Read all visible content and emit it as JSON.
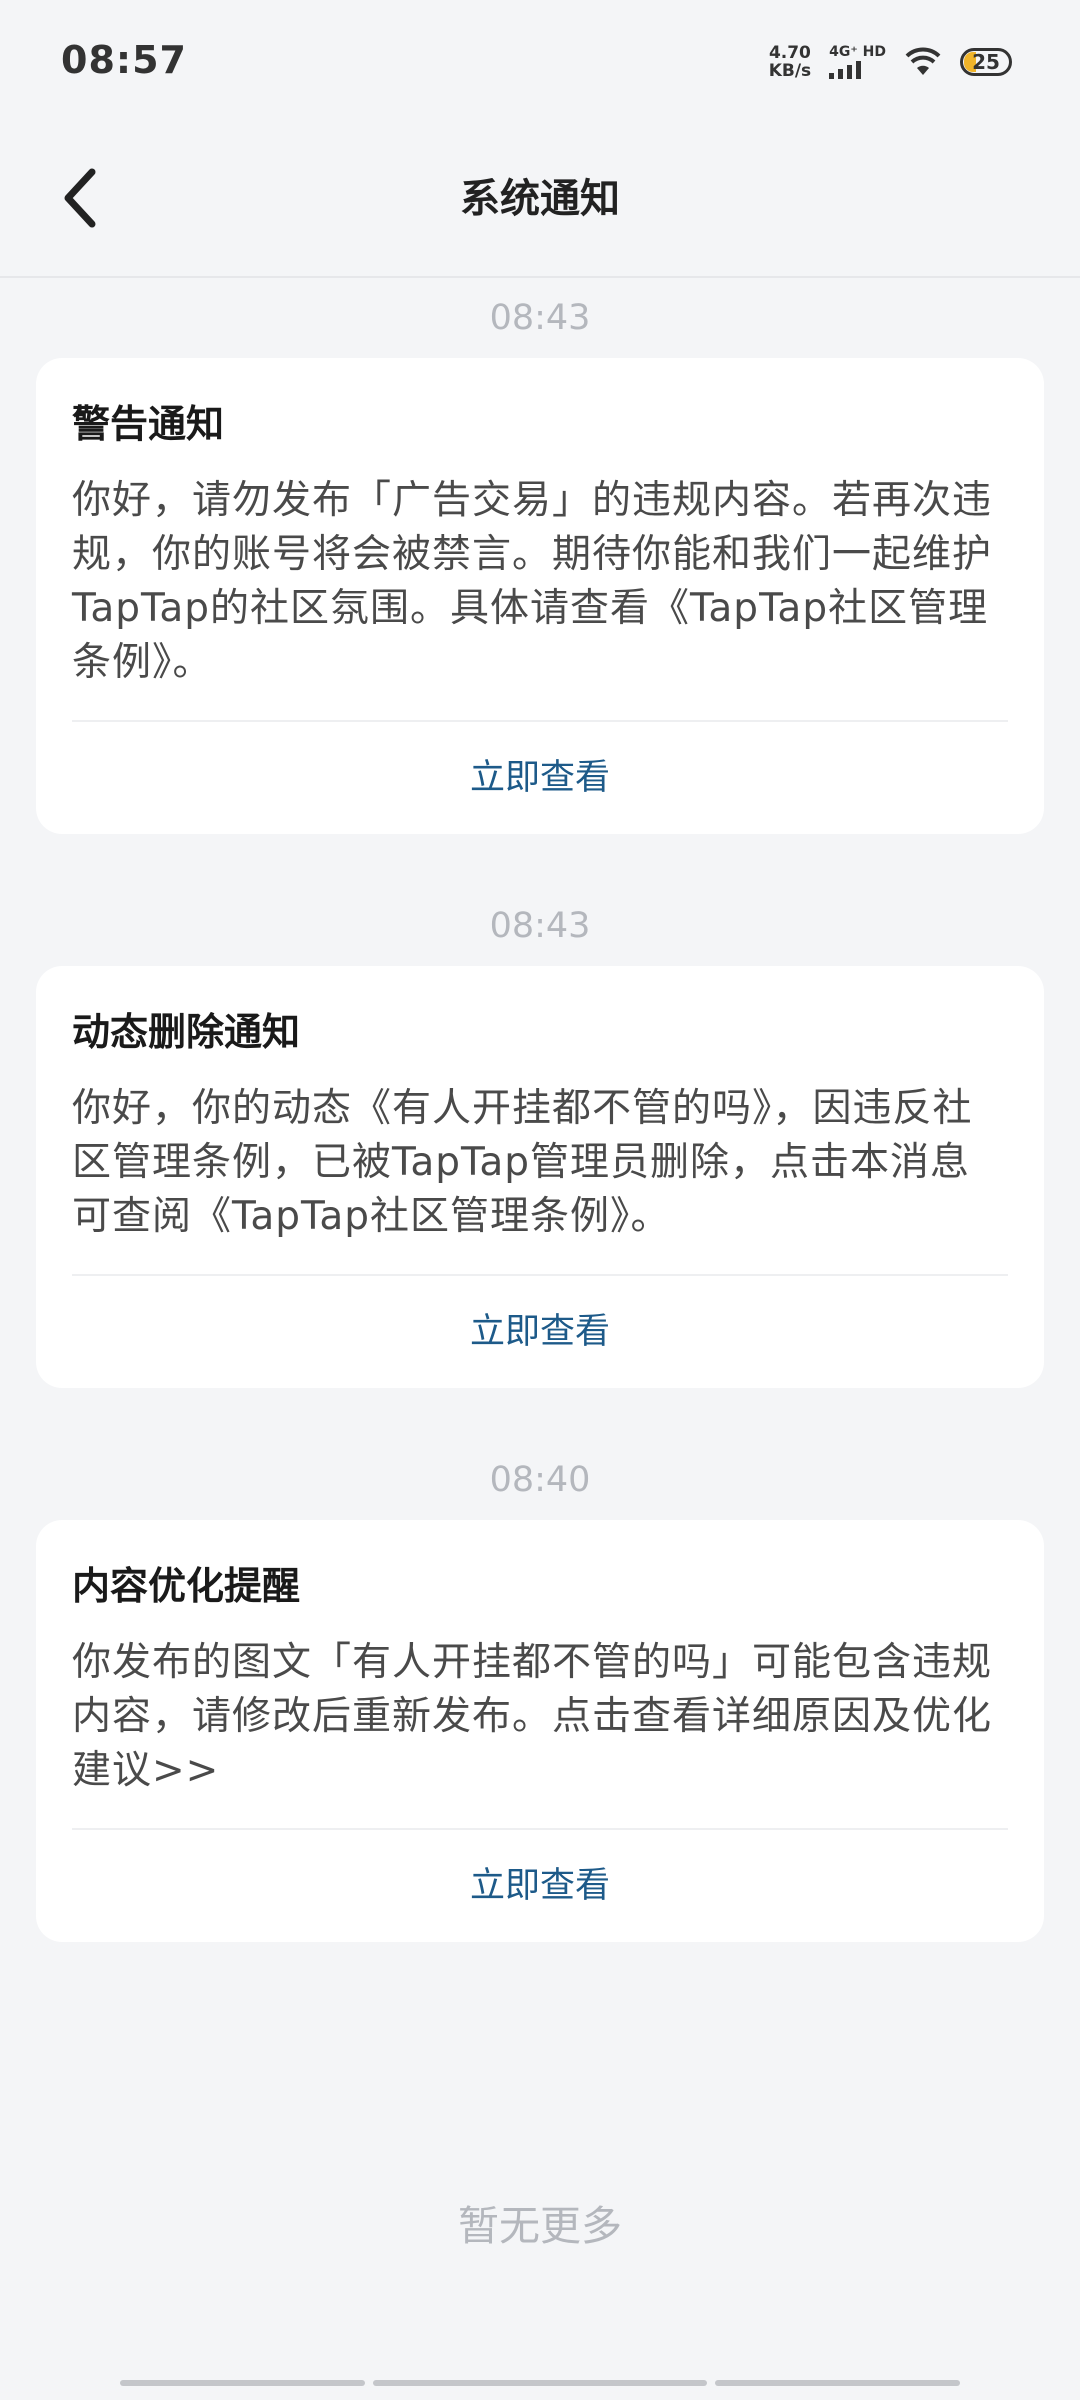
{
  "status_bar": {
    "time": "08:57",
    "speed_value": "4.70",
    "speed_unit": "KB/s",
    "network": "4G⁺ HD",
    "battery": "25"
  },
  "header": {
    "title": "系统通知"
  },
  "notifications": [
    {
      "time": "08:43",
      "title": "警告通知",
      "body": "你好，请勿发布「广告交易」的违规内容。若再次违规，你的账号将会被禁言。期待你能和我们一起维护TapTap的社区氛围。具体请查看《TapTap社区管理条例》。",
      "action": "立即查看"
    },
    {
      "time": "08:43",
      "title": "动态删除通知",
      "body": "你好，你的动态《有人开挂都不管的吗》，因违反社区管理条例，已被TapTap管理员删除，点击本消息可查阅《TapTap社区管理条例》。",
      "action": "立即查看"
    },
    {
      "time": "08:40",
      "title": "内容优化提醒",
      "body": "你发布的图文「有人开挂都不管的吗」可能包含违规内容，请修改后重新发布。点击查看详细原因及优化建议>>",
      "action": "立即查看"
    }
  ],
  "footer": {
    "end_text": "暂无更多"
  },
  "colors": {
    "background": "#f4f5f7",
    "card": "#ffffff",
    "link": "#1d5a89",
    "muted": "#b4b7bd"
  }
}
